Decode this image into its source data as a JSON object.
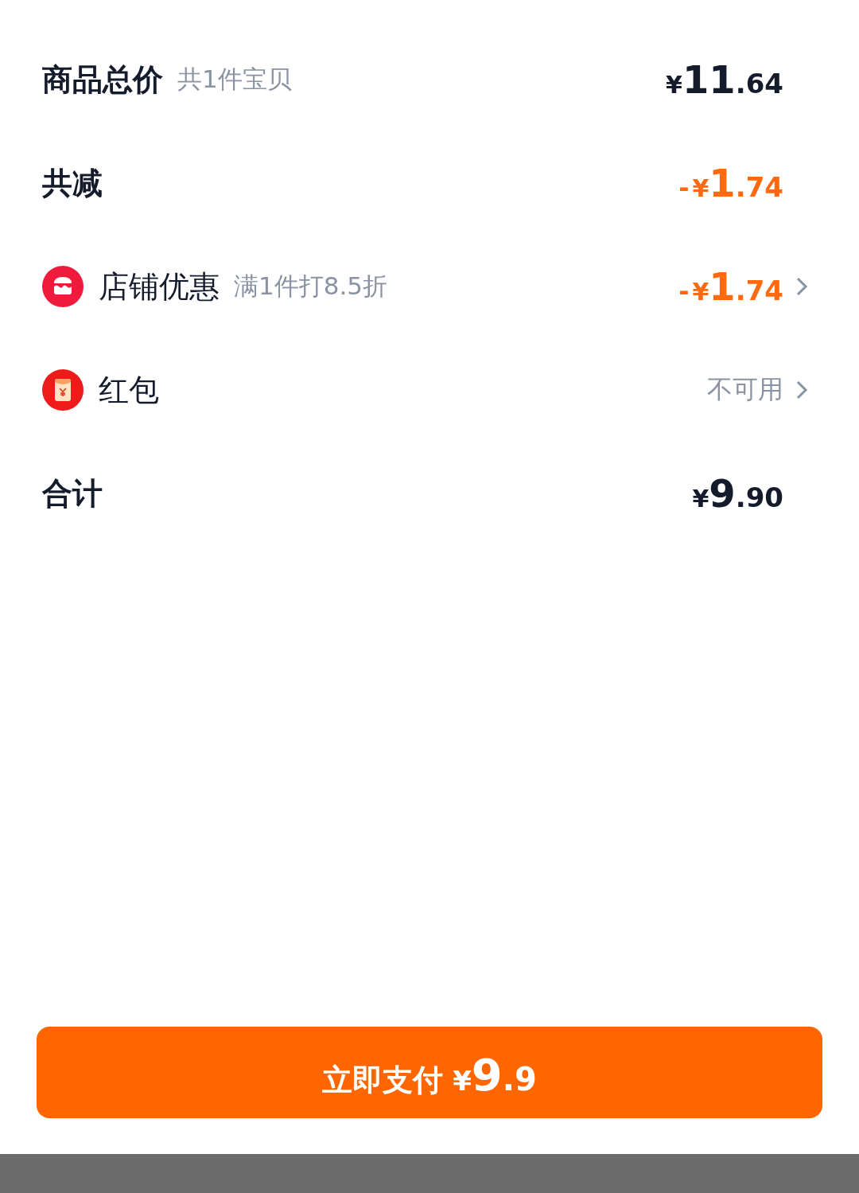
{
  "rows": [
    {
      "kind": "subtotal",
      "label": "商品总价",
      "note": "共1件宝贝",
      "value": {
        "kind": "price",
        "currency": "¥",
        "integer": "11",
        "decimal": ".64",
        "highlight": false
      },
      "chevron": false
    },
    {
      "kind": "subtotal",
      "label": "共减",
      "value": {
        "kind": "price",
        "sign": "-",
        "currency": "¥",
        "integer": "1",
        "decimal": ".74",
        "highlight": true
      },
      "chevron": false
    },
    {
      "kind": "store-discount",
      "label": "店铺优惠",
      "note": "满1件打8.5折",
      "value": {
        "kind": "price",
        "sign": "-",
        "currency": "¥",
        "integer": "1",
        "decimal": ".74",
        "highlight": true
      },
      "chevron": true
    },
    {
      "kind": "red-packet",
      "label": "红包",
      "value": {
        "kind": "text",
        "text": "不可用"
      },
      "chevron": true
    },
    {
      "kind": "subtotal",
      "label": "合计",
      "value": {
        "kind": "price",
        "currency": "¥",
        "integer": "9",
        "decimal": ".90",
        "highlight": false
      },
      "chevron": false
    }
  ],
  "pay_button": {
    "label": "立即支付",
    "currency": "¥",
    "integer": "9",
    "decimal": ".9"
  }
}
